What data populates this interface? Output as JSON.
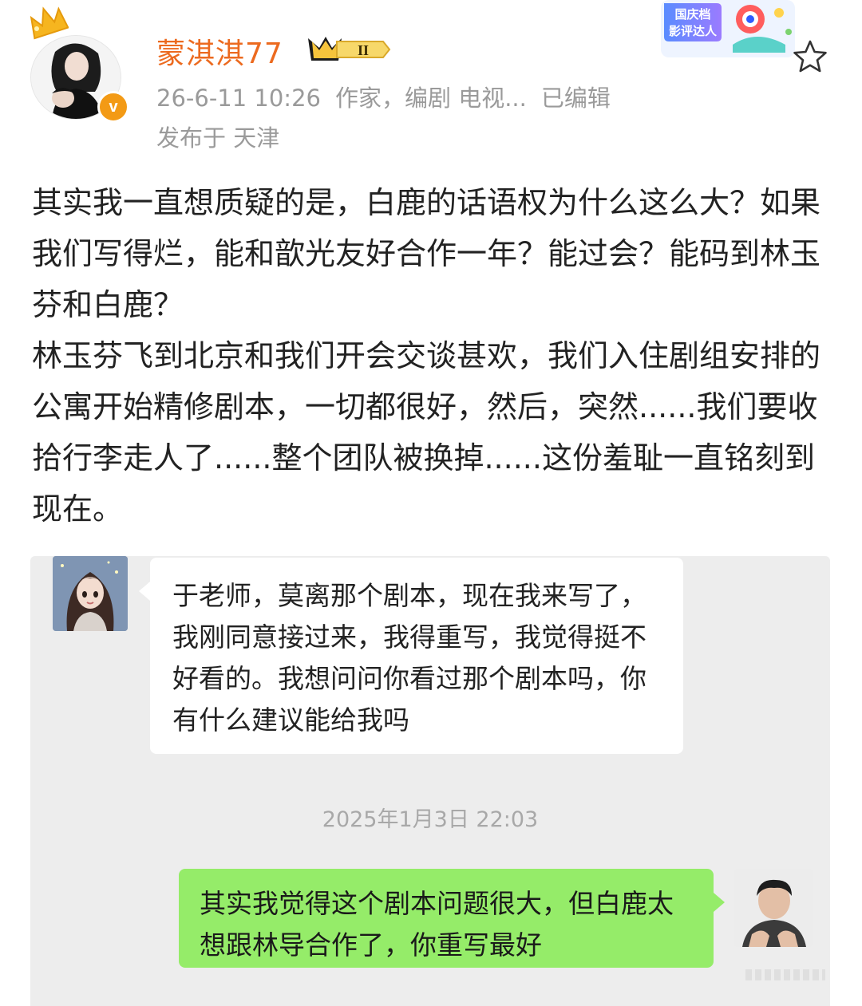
{
  "author": {
    "name": "蒙淇淇77",
    "level_badge": "II",
    "verified_mark": "v"
  },
  "post_meta": {
    "time": "26-6-11 10:26",
    "tags": "作家，编剧 电视...",
    "edited": "已编辑",
    "location": "发布于 天津"
  },
  "promo_badge": {
    "line1": "国庆档",
    "line2": "影评达人"
  },
  "post_body": [
    "其实我一直想质疑的是，白鹿的话语权为什么这么大？如果我们写得烂，能和歆光友好合作一年？能过会？能码到林玉芬和白鹿？",
    "林玉芬飞到北京和我们开会交谈甚欢，我们入住剧组安排的公寓开始精修剧本，一切都很好，然后，突然......我们要收拾行李走人了......整个团队被换掉......这份羞耻一直铭刻到现在。"
  ],
  "chat": {
    "incoming_message": "于老师，莫离那个剧本，现在我来写了，我刚同意接过来，我得重写，我觉得挺不好看的。我想问问你看过那个剧本吗，你有什么建议能给我吗",
    "timestamp": "2025年1月3日 22:03",
    "outgoing_message": "其实我觉得这个剧本问题很大，但白鹿太想跟林导合作了，你重写最好"
  },
  "colors": {
    "username": "#ec6a1f",
    "meta_text": "#9a9a9a",
    "chat_bg": "#ededed",
    "incoming_bubble": "#ffffff",
    "outgoing_bubble": "#95ec69",
    "verified": "#f39a15"
  },
  "icons": {
    "crown": "crown-icon",
    "verified": "verified-v-icon",
    "level": "level-badge-icon",
    "favorite": "star-outline-icon"
  }
}
